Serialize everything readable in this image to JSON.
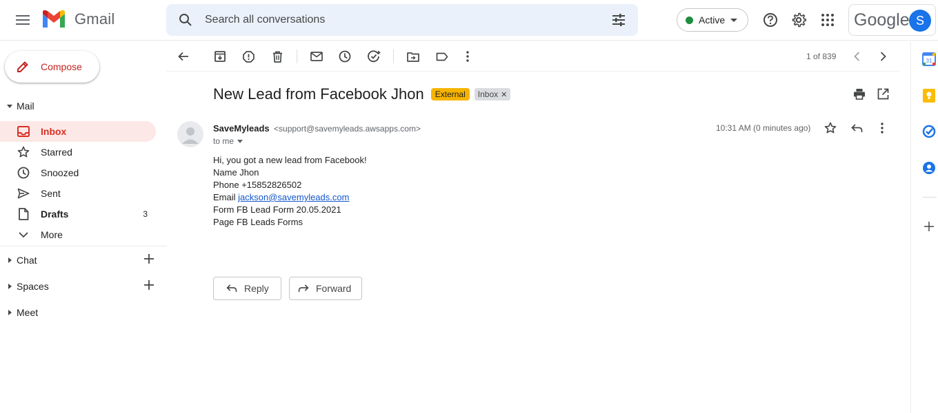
{
  "app": {
    "name": "Gmail"
  },
  "search": {
    "placeholder": "Search all conversations"
  },
  "status": {
    "label": "Active",
    "color": "#1e8e3e"
  },
  "account": {
    "brand": "Google",
    "avatar_letter": "S"
  },
  "compose": {
    "label": "Compose"
  },
  "sidebar": {
    "mail_header": "Mail",
    "items": [
      {
        "label": "Inbox",
        "icon": "inbox-icon",
        "active": true
      },
      {
        "label": "Starred",
        "icon": "star-icon"
      },
      {
        "label": "Snoozed",
        "icon": "clock-icon"
      },
      {
        "label": "Sent",
        "icon": "send-icon"
      },
      {
        "label": "Drafts",
        "icon": "draft-icon",
        "count": "3"
      },
      {
        "label": "More",
        "icon": "chevron-down-icon"
      }
    ],
    "chat_header": "Chat",
    "spaces_header": "Spaces",
    "meet_header": "Meet"
  },
  "toolbar": {
    "pager": "1 of 839"
  },
  "email": {
    "subject": "New Lead from Facebook Jhon",
    "labels": {
      "external": "External",
      "inbox": "Inbox"
    },
    "sender_name": "SaveMyleads",
    "sender_email": "<support@savemyleads.awsapps.com>",
    "to": "to me",
    "time": "10:31 AM (0 minutes ago)",
    "body": {
      "greeting": "Hi, you got a new lead from Facebook!",
      "name_line": "Name Jhon",
      "phone_line": "Phone +15852826502",
      "email_prefix": "Email ",
      "email_link": "jackson@savemyleads.com",
      "form_line": "Form FB Lead Form 20.05.2021",
      "page_line": "Page FB Leads Forms"
    }
  },
  "actions": {
    "reply": "Reply",
    "forward": "Forward"
  },
  "colors": {
    "accent_red": "#d93025",
    "inbox_active_bg": "#fce8e6",
    "external_tag": "#f6b400",
    "link": "#1155cc"
  }
}
